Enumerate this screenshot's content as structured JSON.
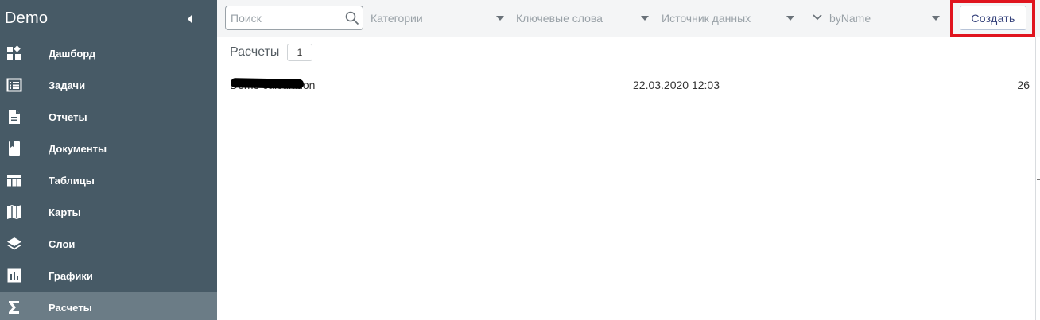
{
  "sidebar": {
    "title": "Demo",
    "items": [
      {
        "label": "Дашборд",
        "icon": "dashboard-icon"
      },
      {
        "label": "Задачи",
        "icon": "tasks-icon"
      },
      {
        "label": "Отчеты",
        "icon": "report-icon"
      },
      {
        "label": "Документы",
        "icon": "document-icon"
      },
      {
        "label": "Таблицы",
        "icon": "table-icon"
      },
      {
        "label": "Карты",
        "icon": "map-icon"
      },
      {
        "label": "Слои",
        "icon": "layers-icon"
      },
      {
        "label": "Графики",
        "icon": "chart-icon"
      },
      {
        "label": "Расчеты",
        "icon": "sigma-icon",
        "active": true
      }
    ]
  },
  "toolbar": {
    "search_placeholder": "Поиск",
    "filters": {
      "categories": "Категории",
      "keywords": "Ключевые слова",
      "datasource": "Источник данных",
      "sort": "byName"
    },
    "create_label": "Создать"
  },
  "main": {
    "title": "Расчеты",
    "count": "1",
    "rows": [
      {
        "name": "Demo calculation",
        "date": "22.03.2020 12:03",
        "count": "26"
      }
    ]
  },
  "colors": {
    "sidebar_bg": "#475a66",
    "sidebar_active": "#6b7c86",
    "highlight": "#e0141e",
    "accent_text": "#33407a"
  }
}
